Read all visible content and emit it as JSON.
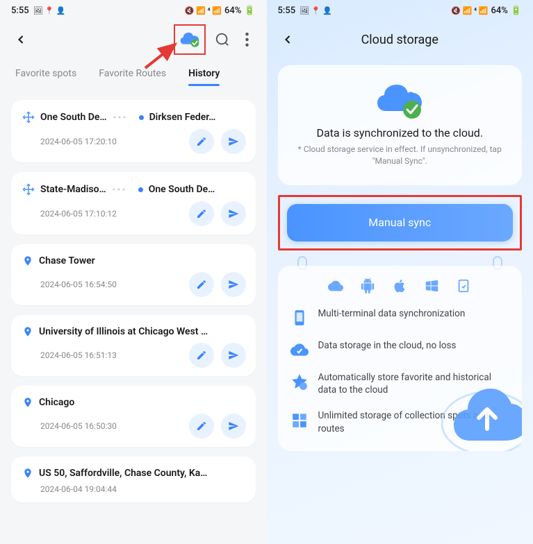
{
  "statusBar": {
    "time": "5:55",
    "battery": "64%"
  },
  "leftScreen": {
    "tabs": [
      {
        "label": "Favorite spots"
      },
      {
        "label": "Favorite Routes"
      },
      {
        "label": "History"
      }
    ],
    "history": [
      {
        "type": "route",
        "from": "One South De…",
        "to": "Dirksen Feder…",
        "time": "2024-06-05 17:20:10"
      },
      {
        "type": "route",
        "from": "State-Madiso…",
        "to": "One South De…",
        "time": "2024-06-05 17:10:12"
      },
      {
        "type": "spot",
        "name": "Chase Tower",
        "time": "2024-06-05 16:54:50"
      },
      {
        "type": "spot",
        "name": "University of Illinois at Chicago West …",
        "time": "2024-06-05 16:51:13"
      },
      {
        "type": "spot",
        "name": "Chicago",
        "time": "2024-06-05 16:50:30"
      },
      {
        "type": "spot",
        "name": "US 50, Saffordville, Chase County, Ka…",
        "time": "2024-06-04 19:04:44"
      }
    ]
  },
  "rightScreen": {
    "title": "Cloud storage",
    "syncTitle": "Data is synchronized to the cloud.",
    "syncSubtitle": "* Cloud storage service in effect. If unsynchronized, tap \"Manual Sync\".",
    "manualSyncLabel": "Manual sync",
    "features": [
      "Multi-terminal data synchronization",
      "Data storage in the cloud, no loss",
      "Automatically store favorite and historical data to the cloud",
      "Unlimited storage of collection spots and routes"
    ]
  }
}
